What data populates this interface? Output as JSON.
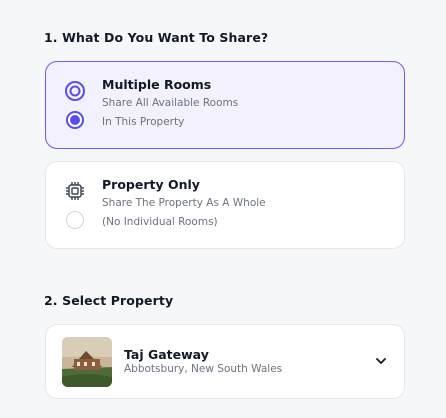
{
  "sections": {
    "share_title": "1. What Do You Want To Share?",
    "property_title": "2. Select Property"
  },
  "options": [
    {
      "title": "Multiple Rooms",
      "line1": "Share All Available Rooms",
      "line2": "In This Property",
      "icon": "target-rooms-icon",
      "selected": true
    },
    {
      "title": "Property Only",
      "line1": "Share The Property As A Whole",
      "line2": "(No Individual Rooms)",
      "icon": "chip-property-icon",
      "selected": false
    }
  ],
  "property": {
    "name": "Taj Gateway",
    "location": "Abbotsbury, New South Wales"
  },
  "colors": {
    "accent": "#5b4ef0",
    "selected_bg": "#f3f0ff",
    "muted_text": "#6b7280"
  }
}
